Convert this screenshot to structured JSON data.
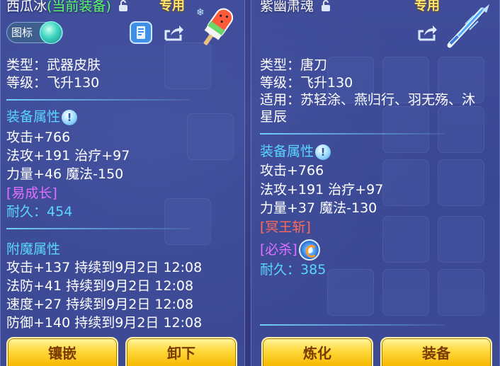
{
  "left_panel": {
    "name": "西瓜冰",
    "equipped_tag": "(当前装备)",
    "exclusive": "专用",
    "badge_label": "图标",
    "type_line": "类型：武器皮肤",
    "level_line": "等级：飞升130",
    "attr_title": "装备属性",
    "attr_lines": [
      "攻击+766",
      "法攻+191 治疗+97",
      "力量+46 魔法-150"
    ],
    "growth_tag": "[易成长]",
    "durability_label": "耐久：",
    "durability_value": "454",
    "enchant_title": "附魔属性",
    "enchant_lines": [
      "攻击+137 持续到9月2日 12:08",
      "法防+41 持续到9月2日 12:08",
      "速度+27 持续到9月2日 12:08",
      "防御+140 持续到9月2日 12:08"
    ],
    "btn_inlay": "镶嵌",
    "btn_unequip": "卸下"
  },
  "right_panel": {
    "name": "紫幽肃魂",
    "exclusive": "专用",
    "type_line": "类型：唐刀",
    "level_line": "等级：飞升130",
    "applicable_line1": "适用：苏轻涂、燕归行、羽无殇、沐",
    "applicable_line2": "星辰",
    "attr_title": "装备属性",
    "attr_lines": [
      "攻击+766",
      "法攻+191 治疗+97",
      "力量+37 魔法-130"
    ],
    "skill_tag": "[冥王斩]",
    "kill_tag": "[必杀]",
    "durability_label": "耐久：",
    "durability_value": "385",
    "btn_refine": "炼化",
    "btn_equip": "装备"
  },
  "colors": {
    "section": "#5ad6ff",
    "equipped": "#5cff6a",
    "exclusive": "#ffe36a",
    "growth": "#e070ff",
    "skill": "#ff6a5a",
    "button": "#ffd83a"
  },
  "icons": [
    "lock-icon",
    "info-icon",
    "share-icon",
    "detail-icon",
    "popsicle-icon",
    "sword-icon",
    "refresh-icon",
    "toggle-knob"
  ]
}
